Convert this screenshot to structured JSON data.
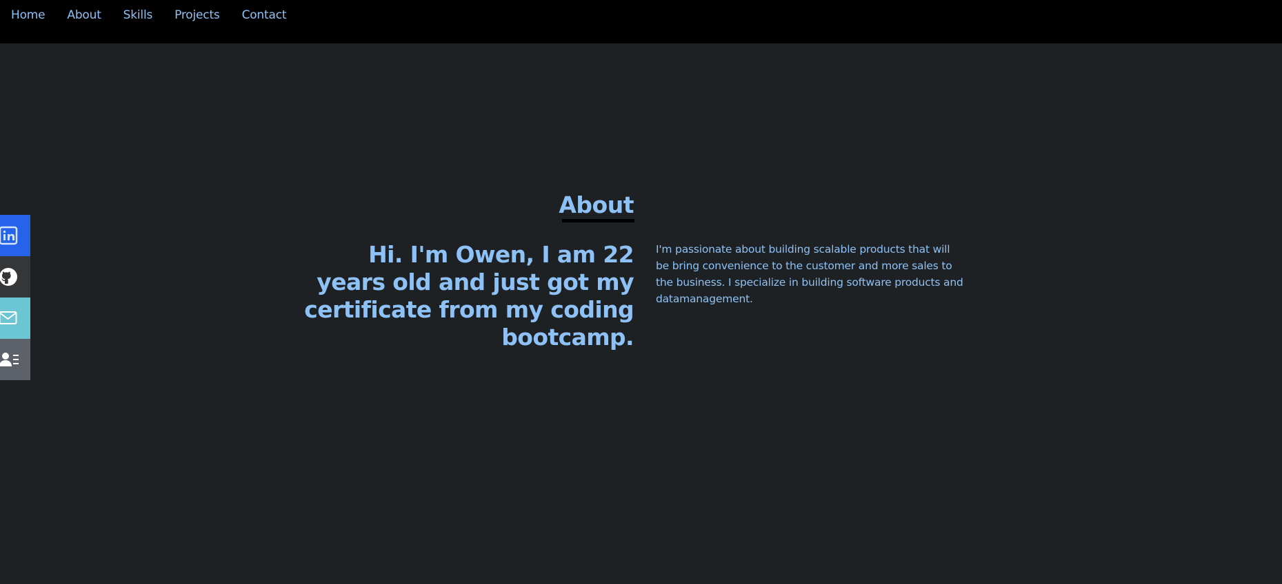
{
  "nav": {
    "items": [
      {
        "label": "Home"
      },
      {
        "label": "About"
      },
      {
        "label": "Skills"
      },
      {
        "label": "Projects"
      },
      {
        "label": "Contact"
      }
    ]
  },
  "social": {
    "items": [
      {
        "icon": "linkedin-icon",
        "color": "#2563eb"
      },
      {
        "icon": "github-icon",
        "color": "#343638"
      },
      {
        "icon": "mail-icon",
        "color": "#6bc5d2"
      },
      {
        "icon": "resume-icon",
        "color": "#5d6169"
      }
    ]
  },
  "about": {
    "title": "About",
    "headline": "Hi. I'm Owen, I am 22 years old and just got my certificate from my coding bootcamp.",
    "bio": "I'm passionate about building scalable products that will be bring convenience to the customer and more sales to the business. I specialize in building software products and datamanagement."
  },
  "colors": {
    "accent": "#8ec1f5",
    "background": "#1e2124",
    "nav_background": "#000000"
  }
}
